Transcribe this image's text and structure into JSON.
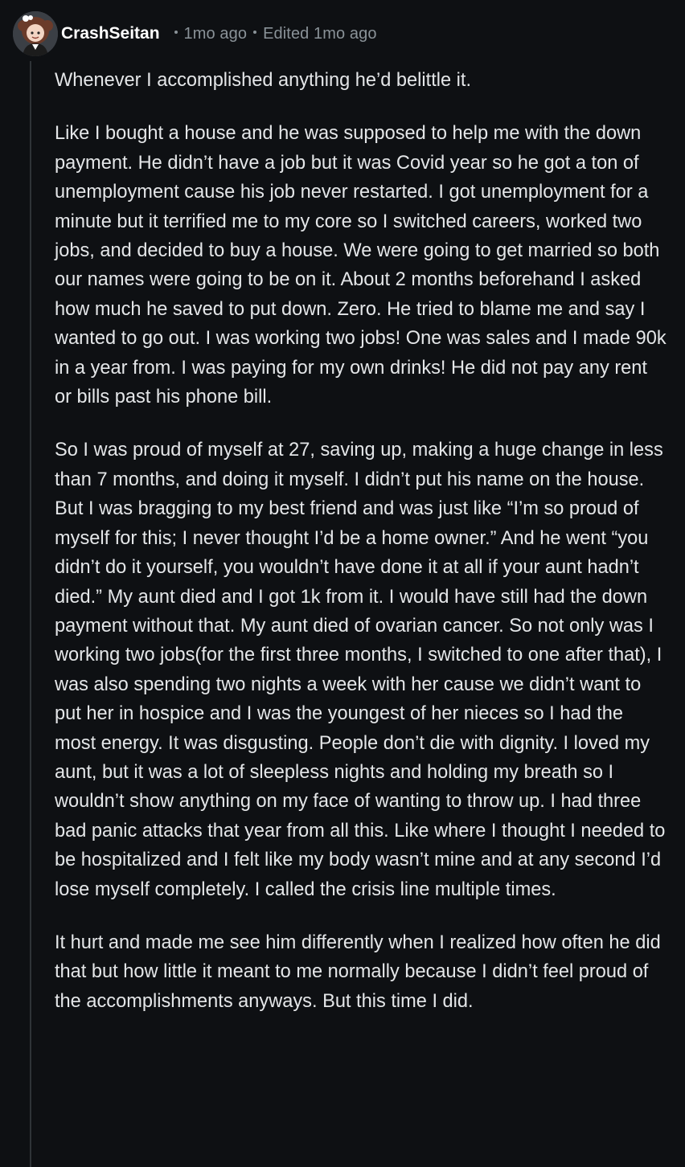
{
  "comment": {
    "author": "CrashSeitan",
    "time": "1mo ago",
    "edited": "Edited 1mo ago",
    "avatar_icon": "avatar-icon",
    "paragraphs": [
      "Whenever I accomplished anything he’d belittle it.",
      "Like I bought a house and he was supposed to help me with the down payment. He didn’t have a job but it was Covid year so he got a ton of unemployment cause his job never restarted. I got unemployment for a minute but it terrified me to my core so I switched careers, worked two jobs, and decided to buy a house. We were going to get married so both our names were going to be on it. About 2 months beforehand I asked how much he saved to put down. Zero. He tried to blame me and say I wanted to go out. I was working two jobs! One was sales and I made 90k in a year from. I was paying for my own drinks! He did not pay any rent or bills past his phone bill.",
      "So I was proud of myself at 27, saving up, making a huge change in less than 7 months, and doing it myself. I didn’t put his name on the house. But I was bragging to my best friend and was just like “I’m so proud of myself for this; I never thought I’d be a home owner.” And he went “you didn’t do it yourself, you wouldn’t have done it at all if your aunt hadn’t died.” My aunt died and I got 1k from it. I would have still had the down payment without that. My aunt died of ovarian cancer. So not only was I working two jobs(for the first three months, I switched to one after that), I was also spending two nights a week with her cause we didn’t want to put her in hospice and I was the youngest of her nieces so I had the most energy. It was disgusting. People don’t die with dignity. I loved my aunt, but it was a lot of sleepless nights and holding my breath so I wouldn’t show anything on my face of wanting to throw up. I had three bad panic attacks that year from all this. Like where I thought I needed to be hospitalized and I felt like my body wasn’t mine and at any second I’d lose myself completely. I called the crisis line multiple times.",
      "It hurt and made me see him differently when I realized how often he did that but how little it meant to me normally because I didn’t feel proud of the accomplishments anyways. But this time I did."
    ]
  },
  "colors": {
    "background": "#0e1013",
    "text": "#e4e6e8",
    "meta": "#8a9298",
    "thread_line": "#2f3337"
  }
}
